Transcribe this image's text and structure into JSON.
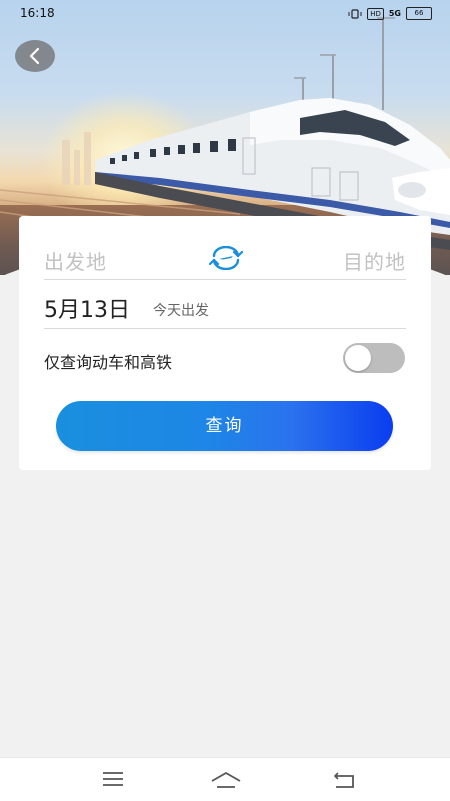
{
  "status_bar": {
    "time": "16:18",
    "hd_label": "HD",
    "signal_label": "5G",
    "battery_label": "66"
  },
  "header": {
    "back_icon": "chevron-left-icon"
  },
  "search_form": {
    "from_placeholder": "出发地",
    "to_placeholder": "目的地",
    "swap_icon": "swap-stations-icon",
    "date": "5月13日",
    "date_note": "今天出发",
    "filter_label": "仅查询动车和高铁",
    "filter_enabled": false,
    "search_label": "查询"
  },
  "bottom_nav": {
    "menu_icon": "menu-icon",
    "home_icon": "home-icon",
    "back_icon": "back-icon"
  },
  "colors": {
    "primary_gradient_start": "#1a8fde",
    "primary_gradient_end": "#0a3df0",
    "placeholder": "#c2c2c2",
    "background": "#f1f1f1"
  }
}
